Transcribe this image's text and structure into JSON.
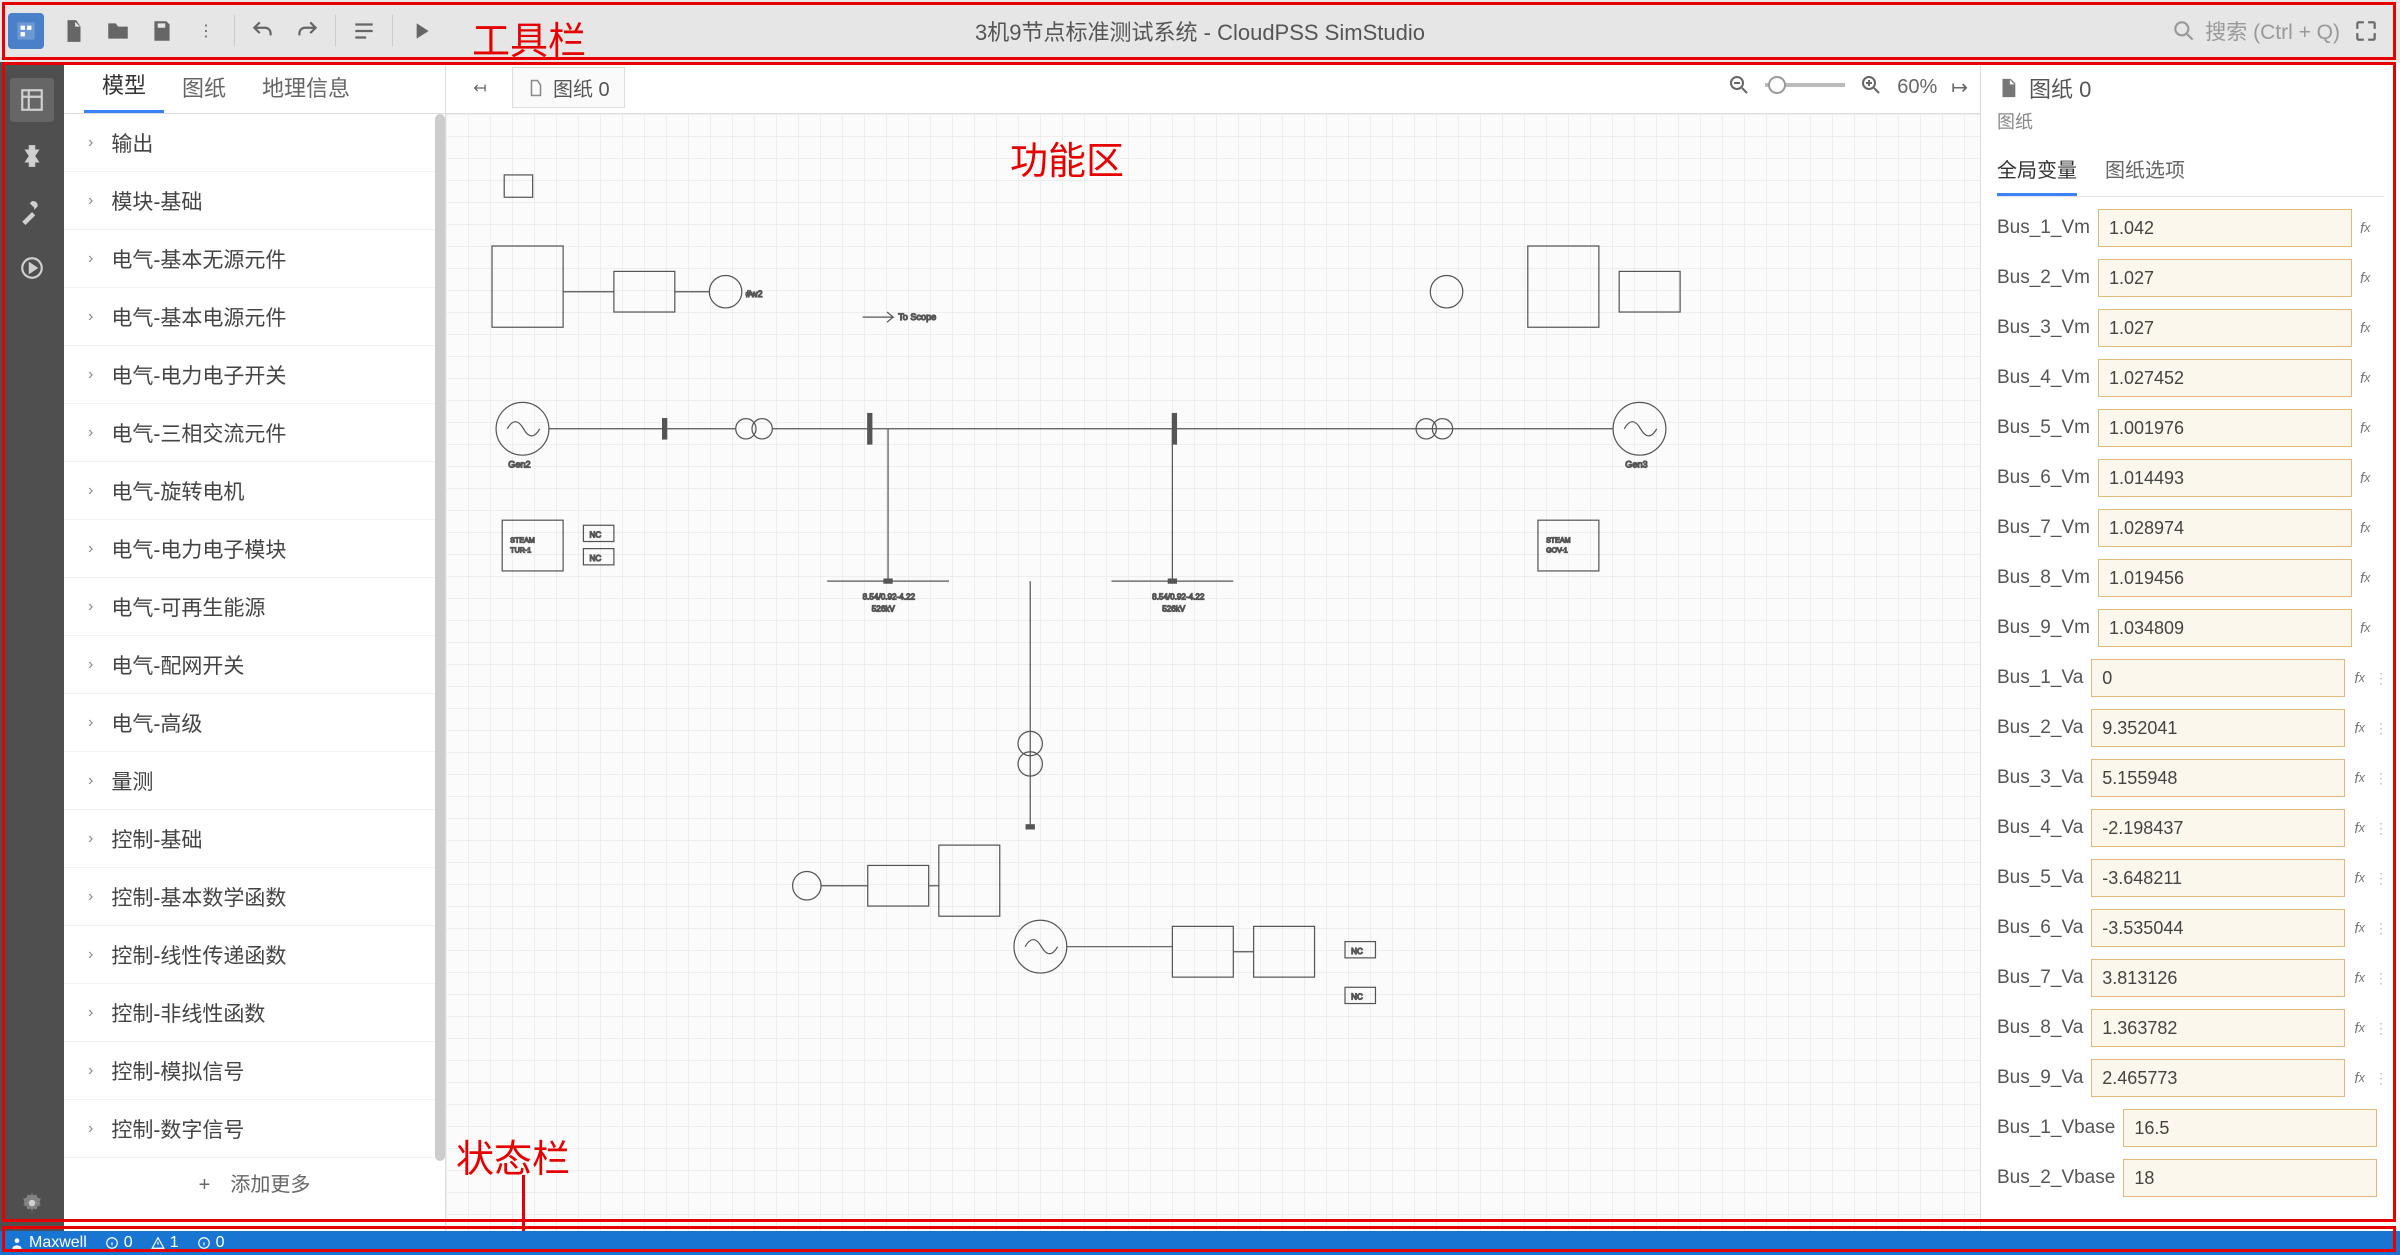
{
  "toolbar": {
    "title": "3机9节点标准测试系统 - CloudPSS SimStudio",
    "search_placeholder": "搜索 (Ctrl + Q)"
  },
  "annotations": {
    "toolbar_label": "工具栏",
    "main_label": "功能区",
    "status_label": "状态栏"
  },
  "left_tabs": [
    "模型",
    "图纸",
    "地理信息"
  ],
  "left_active_tab": 0,
  "tree_items": [
    "输出",
    "模块-基础",
    "电气-基本无源元件",
    "电气-基本电源元件",
    "电气-电力电子开关",
    "电气-三相交流元件",
    "电气-旋转电机",
    "电气-电力电子模块",
    "电气-可再生能源",
    "电气-配网开关",
    "电气-高级",
    "量测",
    "控制-基础",
    "控制-基本数学函数",
    "控制-线性传递函数",
    "控制-非线性函数",
    "控制-模拟信号",
    "控制-数字信号"
  ],
  "add_more": "+　添加更多",
  "canvas_top": {
    "file_tab": "图纸 0",
    "zoom": "60%"
  },
  "right_panel": {
    "title": "图纸 0",
    "subtitle": "图纸",
    "tabs": [
      "全局变量",
      "图纸选项"
    ],
    "active_tab": 0
  },
  "variables": [
    {
      "name": "Bus_1_Vm",
      "value": "1.042"
    },
    {
      "name": "Bus_2_Vm",
      "value": "1.027"
    },
    {
      "name": "Bus_3_Vm",
      "value": "1.027"
    },
    {
      "name": "Bus_4_Vm",
      "value": "1.027452"
    },
    {
      "name": "Bus_5_Vm",
      "value": "1.001976"
    },
    {
      "name": "Bus_6_Vm",
      "value": "1.014493"
    },
    {
      "name": "Bus_7_Vm",
      "value": "1.028974"
    },
    {
      "name": "Bus_8_Vm",
      "value": "1.019456"
    },
    {
      "name": "Bus_9_Vm",
      "value": "1.034809"
    },
    {
      "name": "Bus_1_Va",
      "value": "0"
    },
    {
      "name": "Bus_2_Va",
      "value": "9.352041"
    },
    {
      "name": "Bus_3_Va",
      "value": "5.155948"
    },
    {
      "name": "Bus_4_Va",
      "value": "-2.198437"
    },
    {
      "name": "Bus_5_Va",
      "value": "-3.648211"
    },
    {
      "name": "Bus_6_Va",
      "value": "-3.535044"
    },
    {
      "name": "Bus_7_Va",
      "value": "3.813126"
    },
    {
      "name": "Bus_8_Va",
      "value": "1.363782"
    },
    {
      "name": "Bus_9_Va",
      "value": "2.465773"
    },
    {
      "name": "Bus_1_Vbase",
      "value": "16.5"
    },
    {
      "name": "Bus_2_Vbase",
      "value": "18"
    }
  ],
  "statusbar": {
    "user": "Maxwell",
    "info": "0",
    "warn": "1",
    "err": "0"
  }
}
